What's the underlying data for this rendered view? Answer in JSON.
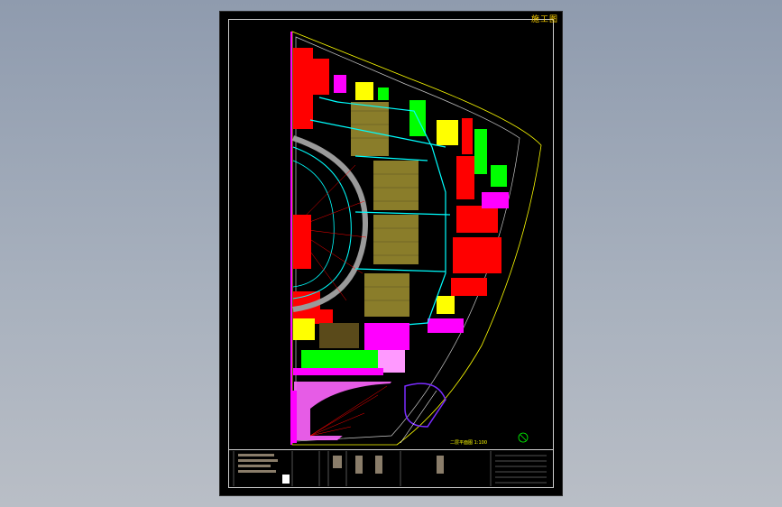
{
  "sheet": {
    "stamp_text": "施工图",
    "plan_title": "二层平面图 1:100",
    "colors": {
      "background": "#000000",
      "frame": "#cfcfcf",
      "wall_cyan": "#00ffff",
      "fill_red": "#ff0000",
      "fill_green": "#00ff00",
      "fill_magenta": "#ff00ff",
      "seat_olive": "#8a7d2a",
      "boundary_yellow": "#ffff00",
      "accent_purple": "#7a2cff"
    }
  },
  "icons": [
    "north-arrow-icon"
  ]
}
